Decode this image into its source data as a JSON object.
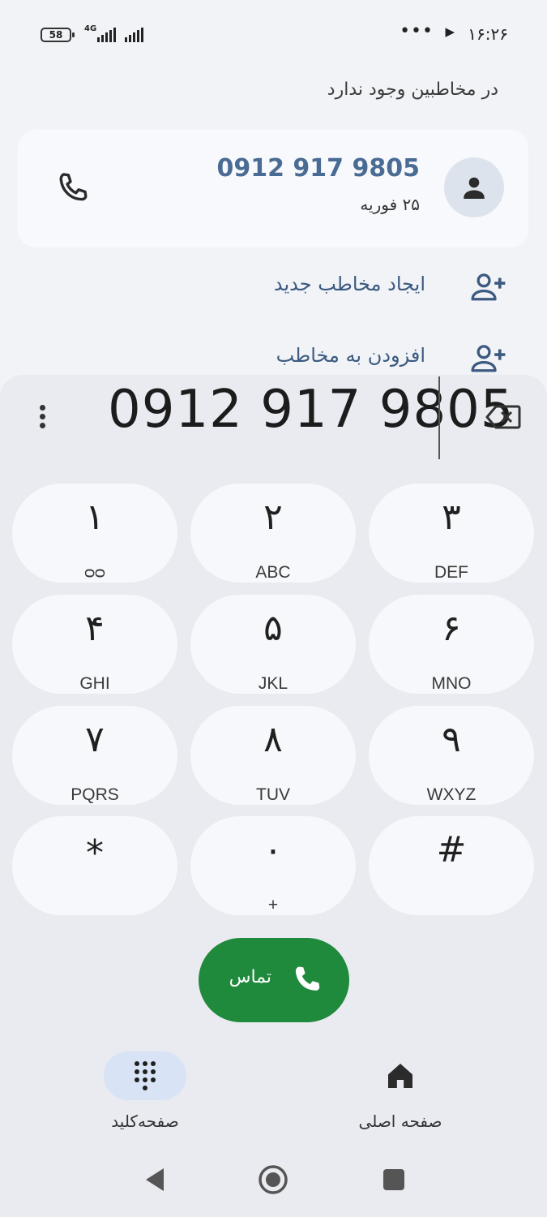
{
  "status_bar": {
    "battery": "58",
    "network": "4G",
    "time": "۱۶:۲۶",
    "more": "•••"
  },
  "header": {
    "not_in_contacts": "در مخاطبین وجود ندارد"
  },
  "call_card": {
    "number": "0912 917 9805",
    "date": "۲۵ فوریه"
  },
  "actions": {
    "create_contact": "ایجاد مخاطب جدید",
    "add_to_contact": "افزودن به مخاطب"
  },
  "dialpad": {
    "entered_number": "0912 917 9805",
    "keys": [
      {
        "digit": "۱",
        "letters": "ᴑᴑ"
      },
      {
        "digit": "۲",
        "letters": "ABC"
      },
      {
        "digit": "۳",
        "letters": "DEF"
      },
      {
        "digit": "۴",
        "letters": "GHI"
      },
      {
        "digit": "۵",
        "letters": "JKL"
      },
      {
        "digit": "۶",
        "letters": "MNO"
      },
      {
        "digit": "۷",
        "letters": "PQRS"
      },
      {
        "digit": "۸",
        "letters": "TUV"
      },
      {
        "digit": "۹",
        "letters": "WXYZ"
      },
      {
        "digit": "*",
        "letters": ""
      },
      {
        "digit": "۰",
        "letters": "+"
      },
      {
        "digit": "#",
        "letters": ""
      }
    ],
    "call_label": "تماس"
  },
  "bottom_nav": {
    "keypad": "صفحه‌کلید",
    "home": "صفحه اصلی"
  },
  "colors": {
    "accent": "#4a6b94",
    "call_green": "#1f8a3b",
    "background": "#f1f3f7",
    "key_bg": "#f7f8fb"
  }
}
